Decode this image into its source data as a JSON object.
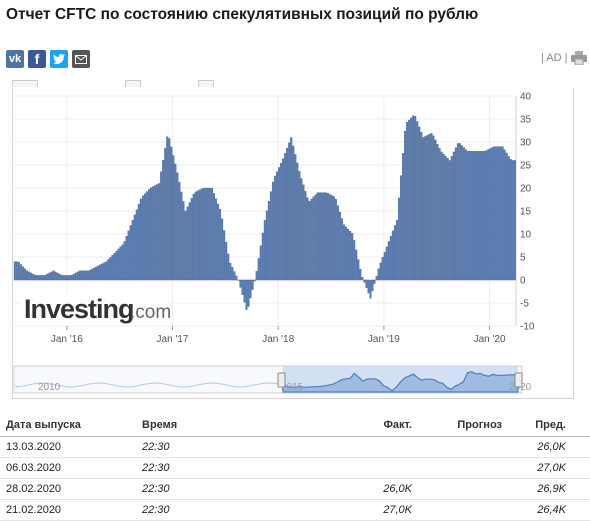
{
  "page": {
    "title": "Отчет CFTC по состоянию спекулятивных позиций по рублю",
    "ad_label": "| AD |",
    "share_icons": [
      "vk-icon",
      "facebook-icon",
      "twitter-icon",
      "email-icon"
    ],
    "colors": {
      "bar": "#5b7cb0",
      "bar_edge": "#3e5f92",
      "navigator_fill": "#c9daf1",
      "navigator_line": "#4f7bbf"
    }
  },
  "chart": {
    "logo_main": "Investing",
    "logo_suffix": ".com",
    "navigator_labels": [
      "2010",
      "2015",
      "2020"
    ]
  },
  "chart_data": {
    "type": "bar",
    "ylim": [
      -10,
      40
    ],
    "yticks": [
      40,
      35,
      30,
      25,
      20,
      15,
      10,
      5,
      0,
      -5,
      -10
    ],
    "xtick_labels": [
      "Jan '16",
      "Jan '17",
      "Jan '18",
      "Jan '19",
      "Jan '20"
    ],
    "xtick_dates": [
      "2016-01",
      "2017-01",
      "2018-01",
      "2019-01",
      "2020-01"
    ],
    "x_start": "2015-07",
    "x_end": "2020-03",
    "grid": true,
    "legend": "none",
    "x": [
      "2015-07",
      "2015-08",
      "2015-09",
      "2015-10",
      "2015-11",
      "2015-12",
      "2016-01",
      "2016-02",
      "2016-03",
      "2016-04",
      "2016-05",
      "2016-06",
      "2016-07",
      "2016-08",
      "2016-09",
      "2016-10",
      "2016-11",
      "2016-12",
      "2017-01",
      "2017-02",
      "2017-03",
      "2017-04",
      "2017-05",
      "2017-06",
      "2017-07",
      "2017-08",
      "2017-09",
      "2017-10",
      "2017-11",
      "2017-12",
      "2018-01",
      "2018-02",
      "2018-03",
      "2018-04",
      "2018-05",
      "2018-06",
      "2018-07",
      "2018-08",
      "2018-09",
      "2018-10",
      "2018-11",
      "2018-12",
      "2019-01",
      "2019-02",
      "2019-03",
      "2019-04",
      "2019-05",
      "2019-06",
      "2019-07",
      "2019-08",
      "2019-09",
      "2019-10",
      "2019-11",
      "2019-12",
      "2020-01",
      "2020-02",
      "2020-03"
    ],
    "values": [
      4,
      2,
      1,
      1,
      2,
      1,
      1,
      2,
      2,
      3,
      4,
      6,
      8,
      13,
      18,
      20,
      21,
      32,
      24,
      15,
      19,
      20,
      20,
      15,
      4,
      0,
      -7,
      1,
      13,
      22,
      26,
      31,
      23,
      17,
      19,
      19,
      18,
      12,
      10,
      1,
      -4,
      3,
      8,
      13,
      34,
      36,
      31,
      32,
      28,
      26,
      30,
      28,
      28,
      28,
      29,
      29,
      26
    ]
  },
  "table": {
    "headers": [
      "Дата выпуска",
      "Время",
      "Факт.",
      "Прогноз",
      "Пред."
    ],
    "rows": [
      {
        "date": "13.03.2020",
        "time": "22:30",
        "actual": "",
        "forecast": "",
        "previous": "26,0K"
      },
      {
        "date": "06.03.2020",
        "time": "22:30",
        "actual": "",
        "forecast": "",
        "previous": "27,0K"
      },
      {
        "date": "28.02.2020",
        "time": "22:30",
        "actual": "26,0K",
        "forecast": "",
        "previous": "26,9K"
      },
      {
        "date": "21.02.2020",
        "time": "22:30",
        "actual": "27,0K",
        "forecast": "",
        "previous": "26,4K"
      }
    ]
  }
}
